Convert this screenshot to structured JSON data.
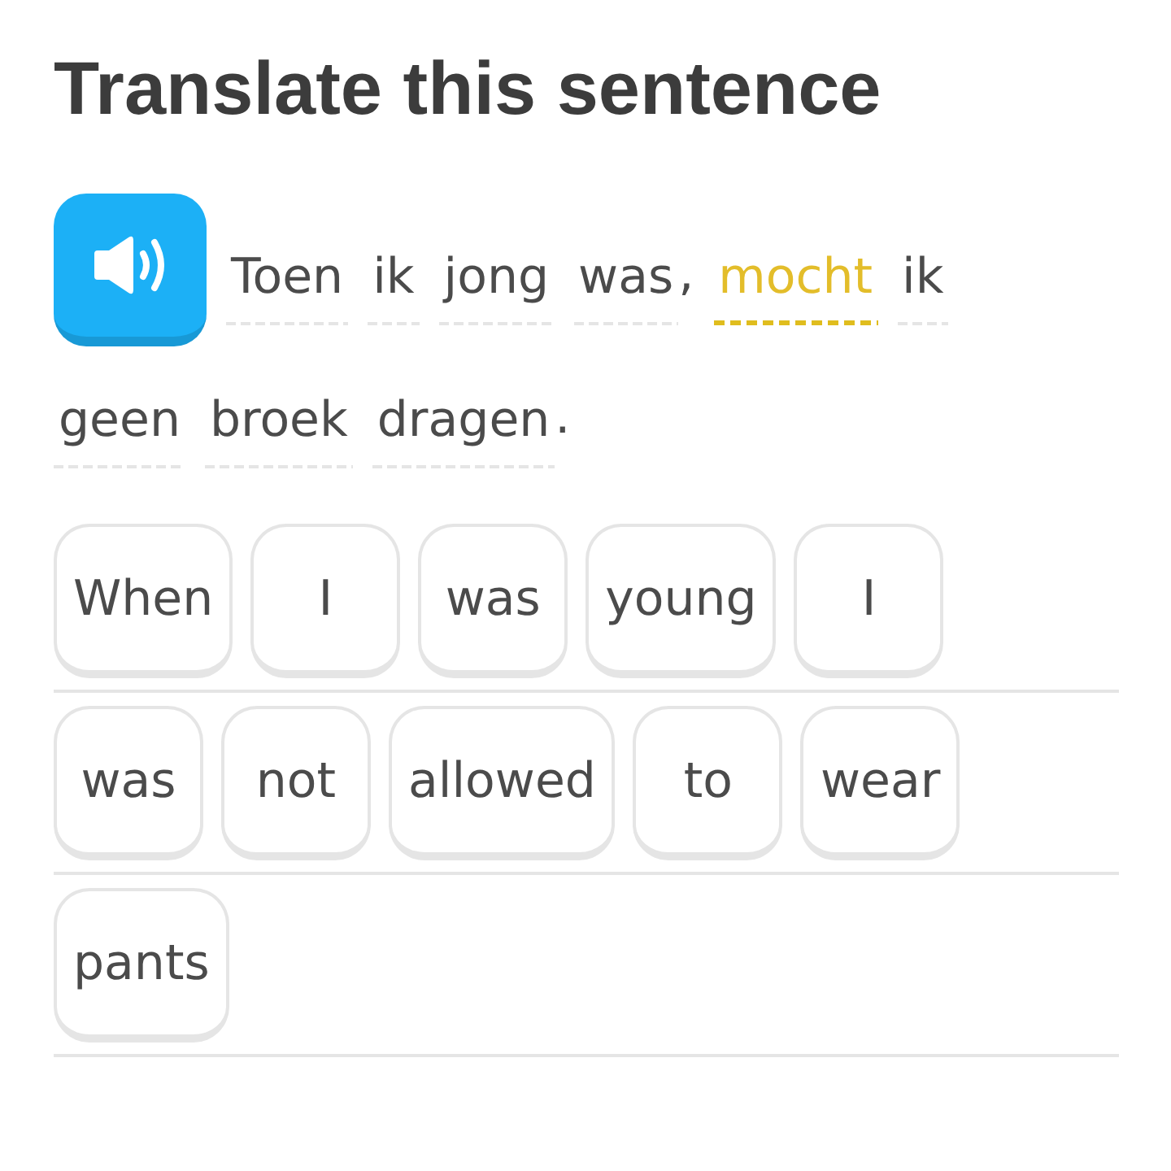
{
  "title": "Translate this sentence",
  "sentence": {
    "lines": [
      [
        {
          "kind": "word",
          "text": "Toen",
          "selected": false
        },
        {
          "kind": "word",
          "text": "ik",
          "selected": false
        },
        {
          "kind": "word",
          "text": "jong",
          "selected": false
        },
        {
          "kind": "word",
          "text": "was",
          "selected": false
        },
        {
          "kind": "punctuation",
          "text": ","
        },
        {
          "kind": "word",
          "text": "mocht",
          "selected": true
        },
        {
          "kind": "word",
          "text": "ik",
          "selected": false
        }
      ],
      [
        {
          "kind": "word",
          "text": "geen",
          "selected": false
        },
        {
          "kind": "word",
          "text": "broek",
          "selected": false
        },
        {
          "kind": "word",
          "text": "dragen",
          "selected": false
        },
        {
          "kind": "punctuation",
          "text": "."
        }
      ]
    ]
  },
  "answer": {
    "lines": [
      {
        "tiles": [
          "When",
          "I",
          "was",
          "young",
          "I"
        ]
      },
      {
        "tiles": [
          "was",
          "not",
          "allowed",
          "to",
          "wear"
        ]
      },
      {
        "tiles": [
          "pants"
        ]
      }
    ]
  }
}
